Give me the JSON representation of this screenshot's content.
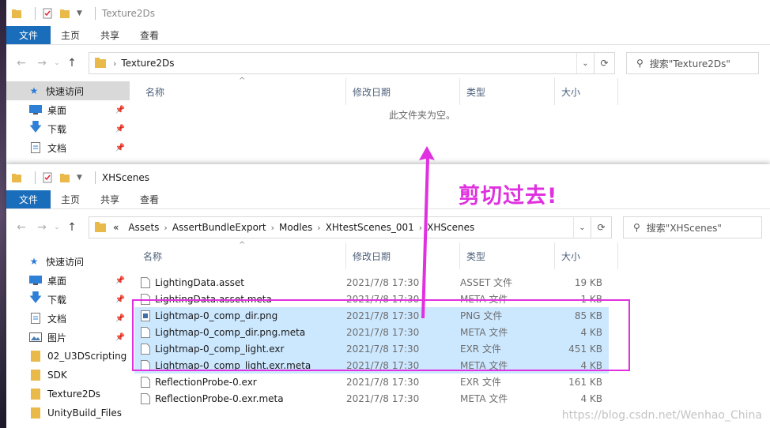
{
  "window1": {
    "title": "Texture2Ds",
    "ribbon": [
      "文件",
      "主页",
      "共享",
      "查看"
    ],
    "address": [
      "Texture2Ds"
    ],
    "search_placeholder": "搜索\"Texture2Ds\"",
    "columns": {
      "name": "名称",
      "date": "修改日期",
      "type": "类型",
      "size": "大小"
    },
    "empty_message": "此文件夹为空。",
    "sidebar": [
      {
        "label": "快速访问",
        "icon": "star-icon",
        "pinned": false
      },
      {
        "label": "桌面",
        "icon": "desktop-icon",
        "pinned": true
      },
      {
        "label": "下载",
        "icon": "download-icon",
        "pinned": true
      },
      {
        "label": "文档",
        "icon": "document-icon",
        "pinned": true
      }
    ]
  },
  "window2": {
    "title": "XHScenes",
    "ribbon": [
      "文件",
      "主页",
      "共享",
      "查看"
    ],
    "address_prefix": "«",
    "address": [
      "Assets",
      "AssertBundleExport",
      "Modles",
      "XHtestScenes_001",
      "XHScenes"
    ],
    "search_placeholder": "搜索\"XHScenes\"",
    "columns": {
      "name": "名称",
      "date": "修改日期",
      "type": "类型",
      "size": "大小"
    },
    "sidebar": [
      {
        "label": "快速访问",
        "icon": "star-icon"
      },
      {
        "label": "桌面",
        "icon": "desktop-icon"
      },
      {
        "label": "下载",
        "icon": "download-icon"
      },
      {
        "label": "文档",
        "icon": "document-icon"
      },
      {
        "label": "图片",
        "icon": "pictures-icon"
      },
      {
        "label": "02_U3DScripting",
        "icon": "folder-icon"
      },
      {
        "label": "SDK",
        "icon": "folder-icon"
      },
      {
        "label": "Texture2Ds",
        "icon": "folder-icon"
      },
      {
        "label": "UnityBuild_Files",
        "icon": "folder-icon"
      }
    ],
    "files": [
      {
        "name": "LightingData.asset",
        "date": "2021/7/8 17:30",
        "type": "ASSET 文件",
        "size": "19 KB",
        "selected": false,
        "icon": "file-icon"
      },
      {
        "name": "LightingData.asset.meta",
        "date": "2021/7/8 17:30",
        "type": "META 文件",
        "size": "1 KB",
        "selected": false,
        "icon": "file-icon"
      },
      {
        "name": "Lightmap-0_comp_dir.png",
        "date": "2021/7/8 17:30",
        "type": "PNG 文件",
        "size": "85 KB",
        "selected": true,
        "icon": "image-file-icon"
      },
      {
        "name": "Lightmap-0_comp_dir.png.meta",
        "date": "2021/7/8 17:30",
        "type": "META 文件",
        "size": "4 KB",
        "selected": true,
        "icon": "file-icon"
      },
      {
        "name": "Lightmap-0_comp_light.exr",
        "date": "2021/7/8 17:30",
        "type": "EXR 文件",
        "size": "451 KB",
        "selected": true,
        "icon": "file-icon"
      },
      {
        "name": "Lightmap-0_comp_light.exr.meta",
        "date": "2021/7/8 17:30",
        "type": "META 文件",
        "size": "4 KB",
        "selected": true,
        "icon": "file-icon"
      },
      {
        "name": "ReflectionProbe-0.exr",
        "date": "2021/7/8 17:30",
        "type": "EXR 文件",
        "size": "161 KB",
        "selected": false,
        "icon": "file-icon"
      },
      {
        "name": "ReflectionProbe-0.exr.meta",
        "date": "2021/7/8 17:30",
        "type": "META 文件",
        "size": "4 KB",
        "selected": false,
        "icon": "file-icon"
      }
    ]
  },
  "annotation": "剪切过去!",
  "watermark": "https://blog.csdn.net/Wenhao_China",
  "colors": {
    "accent": "#1a6dbb",
    "selection": "#cce8ff",
    "annotation": "#e030e0"
  }
}
